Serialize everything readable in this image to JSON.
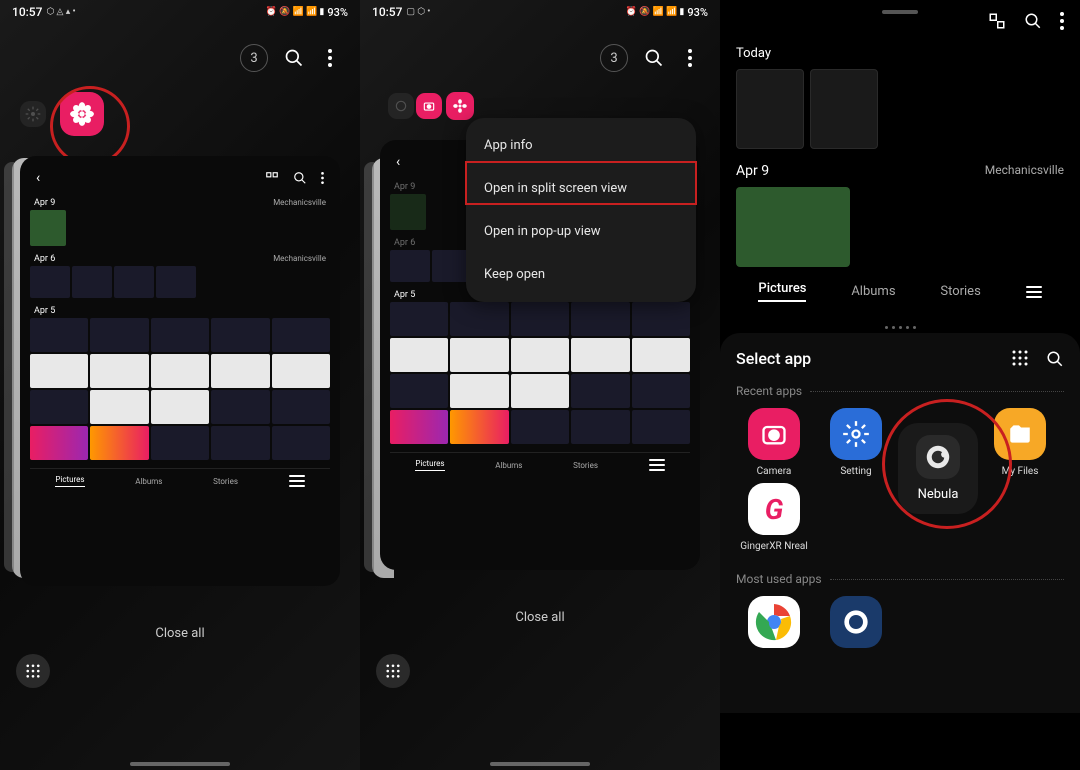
{
  "status": {
    "time": "10:57",
    "battery": "93%",
    "icons_left": "⬡ ◬ ▴ •",
    "icons_right": "⏰ 🔕 📶 📶 ▮"
  },
  "recents": {
    "count": "3",
    "close_all": "Close all"
  },
  "gallery_card": {
    "date1": "Apr 9",
    "date2": "Apr 6",
    "date3": "Apr 5",
    "location": "Mechanicsville",
    "tabs": {
      "pictures": "Pictures",
      "albums": "Albums",
      "stories": "Stories"
    }
  },
  "context_menu": {
    "app_info": "App info",
    "split": "Open in split screen view",
    "popup": "Open in pop-up view",
    "keep": "Keep open"
  },
  "panel3": {
    "today": "Today",
    "date": "Apr 9",
    "location": "Mechanicsville",
    "tabs": {
      "pictures": "Pictures",
      "albums": "Albums",
      "stories": "Stories"
    },
    "select_app": "Select app",
    "recent_apps": "Recent apps",
    "most_used": "Most used apps",
    "apps": {
      "camera": "Camera",
      "settings": "Setting",
      "nebula": "Nebula",
      "files": "My Files",
      "ginger": "GingerXR Nreal"
    }
  }
}
